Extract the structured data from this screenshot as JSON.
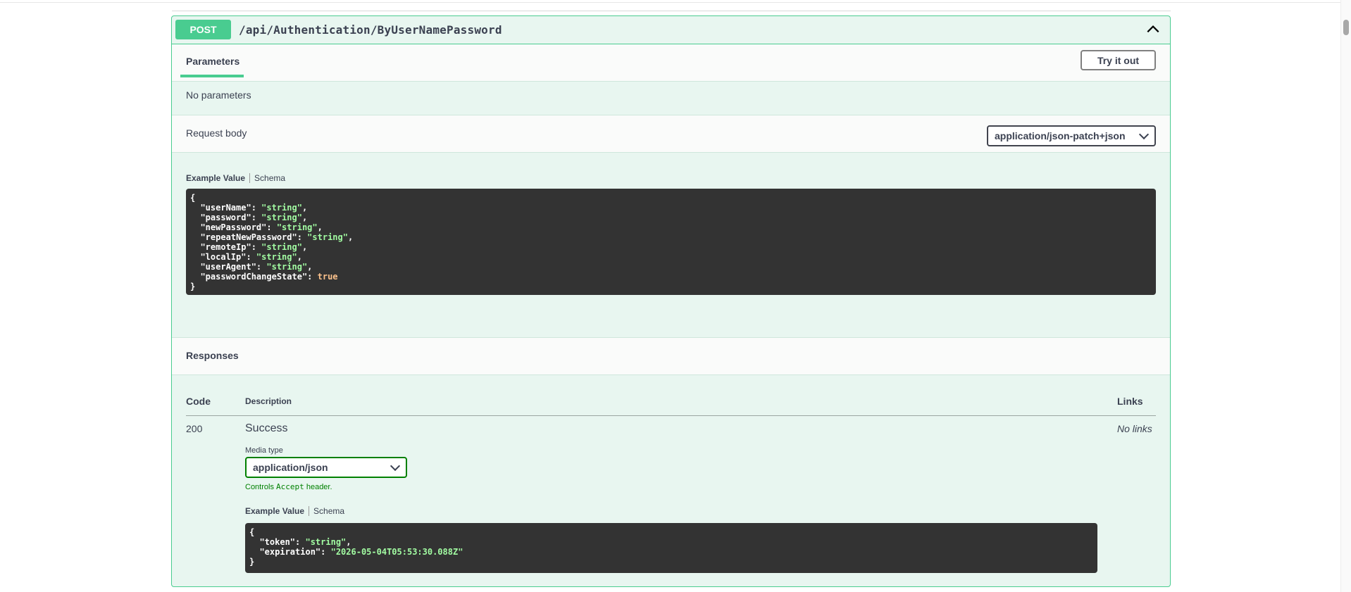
{
  "operation": {
    "method": "POST",
    "path": "/api/Authentication/ByUserNamePassword"
  },
  "parameters": {
    "tab_label": "Parameters",
    "try_button": "Try it out",
    "empty_text": "No parameters"
  },
  "request_body": {
    "title": "Request body",
    "content_type": "application/json-patch+json",
    "example_tab": "Example Value",
    "schema_tab": "Schema",
    "example_lines": [
      {
        "key": "userName",
        "value": "\"string\"",
        "type": "str"
      },
      {
        "key": "password",
        "value": "\"string\"",
        "type": "str"
      },
      {
        "key": "newPassword",
        "value": "\"string\"",
        "type": "str"
      },
      {
        "key": "repeatNewPassword",
        "value": "\"string\"",
        "type": "str"
      },
      {
        "key": "remoteIp",
        "value": "\"string\"",
        "type": "str"
      },
      {
        "key": "localIp",
        "value": "\"string\"",
        "type": "str"
      },
      {
        "key": "userAgent",
        "value": "\"string\"",
        "type": "str"
      },
      {
        "key": "passwordChangeState",
        "value": "true",
        "type": "bool"
      }
    ]
  },
  "responses": {
    "title": "Responses",
    "col_code": "Code",
    "col_description": "Description",
    "col_links": "Links",
    "rows": [
      {
        "code": "200",
        "description": "Success",
        "links": "No links",
        "media_type_label": "Media type",
        "media_type": "application/json",
        "controls_prefix": "Controls ",
        "controls_code": "Accept",
        "controls_suffix": " header.",
        "example_tab": "Example Value",
        "schema_tab": "Schema",
        "example_lines": [
          {
            "key": "token",
            "value": "\"string\"",
            "type": "str"
          },
          {
            "key": "expiration",
            "value": "\"2026-05-04T05:53:30.088Z\"",
            "type": "str"
          }
        ]
      }
    ]
  },
  "colors": {
    "post_green": "#49cc90",
    "block_bg": "#e8f6f0",
    "code_bg": "#333333",
    "string_color": "#a2fca2",
    "bool_color": "#fcc28c"
  }
}
